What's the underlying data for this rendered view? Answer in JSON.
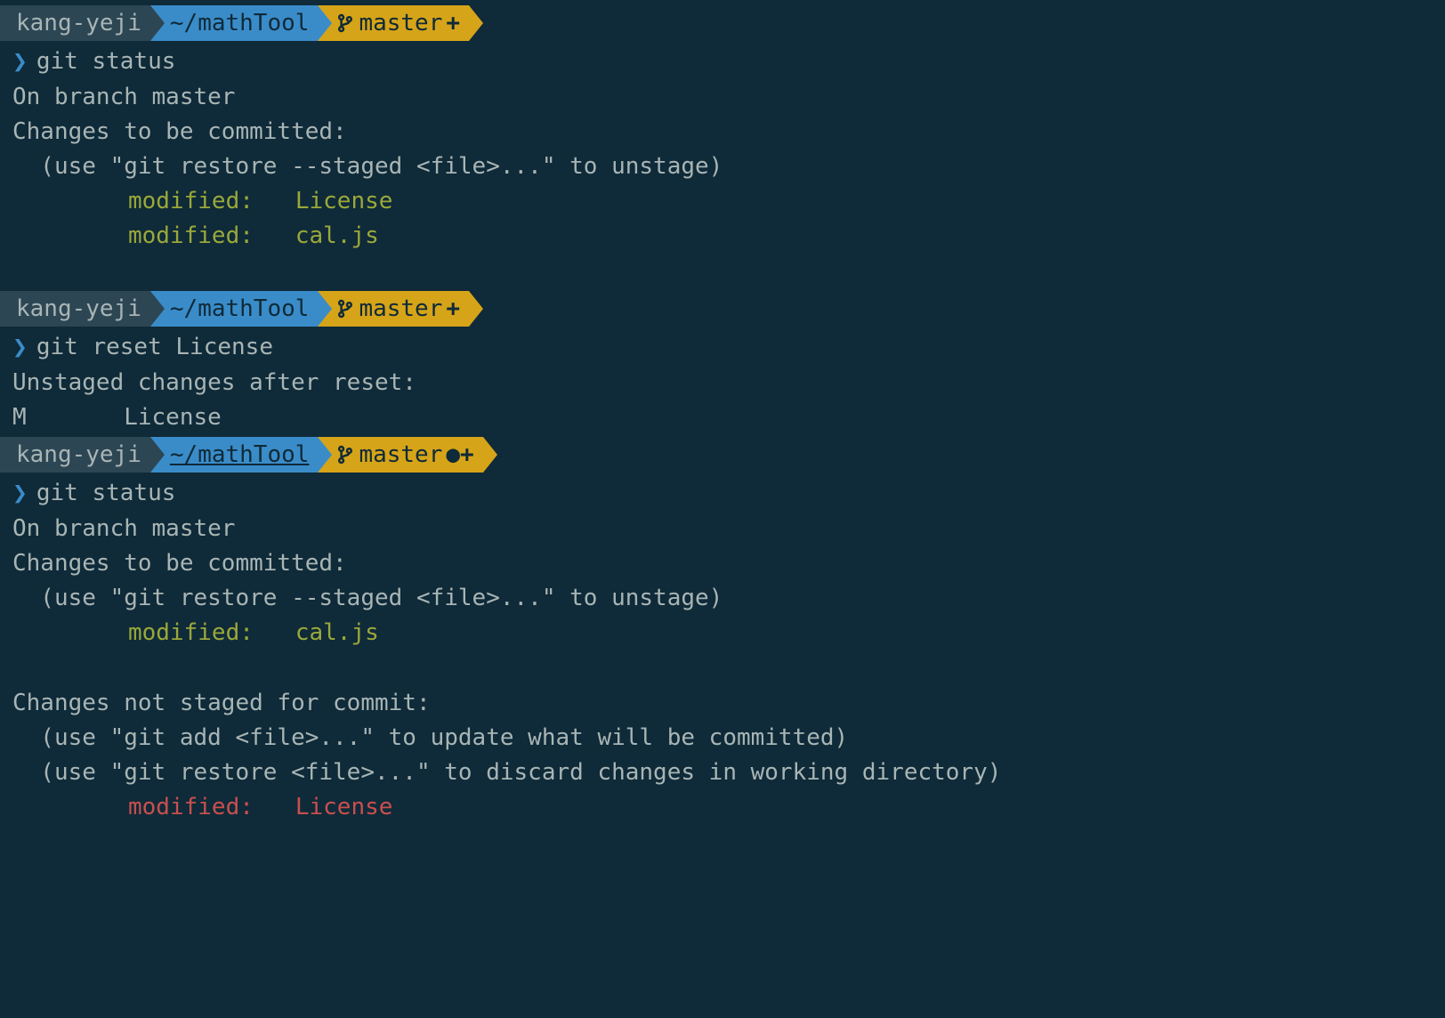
{
  "prompts": {
    "user": "kang-yeji",
    "path": "~/mathTool",
    "branch": "master",
    "indicator_plus": "+",
    "indicator_dot_plus": "●+"
  },
  "block1": {
    "cmd": "git status",
    "out1": "On branch master",
    "out2": "Changes to be committed:",
    "out3": "  (use \"git restore --staged <file>...\" to unstage)",
    "staged1_label": "modified:   ",
    "staged1_file": "License",
    "staged2_label": "modified:   ",
    "staged2_file": "cal.js"
  },
  "block2": {
    "cmd": "git reset License",
    "out1": "Unstaged changes after reset:",
    "out2": "M       License"
  },
  "block3": {
    "cmd": "git status",
    "out1": "On branch master",
    "out2": "Changes to be committed:",
    "out3": "  (use \"git restore --staged <file>...\" to unstage)",
    "staged1_label": "modified:   ",
    "staged1_file": "cal.js",
    "out4": "Changes not staged for commit:",
    "out5": "  (use \"git add <file>...\" to update what will be committed)",
    "out6": "  (use \"git restore <file>...\" to discard changes in working directory)",
    "unstaged1_label": "modified:   ",
    "unstaged1_file": "License"
  }
}
